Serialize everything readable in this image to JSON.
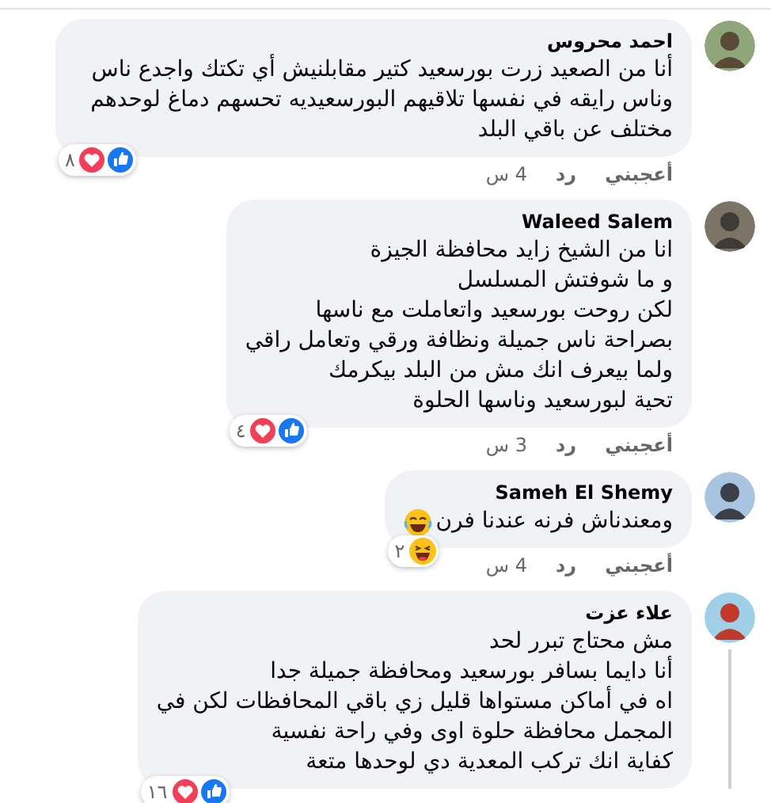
{
  "comments": [
    {
      "author": "احمد محروس",
      "text": [
        "أنا من الصعيد زرت بورسعيد كتير مقابلنيش أي تكتك واجدع ناس وناس رايقه في نفسها تلاقيهم البورسعيديه تحسهم دماغ لوحدهم مختلف عن باقي البلد"
      ],
      "trailing_emoji": false,
      "reactions": [
        {
          "kind": "like"
        },
        {
          "kind": "love"
        }
      ],
      "reaction_count": "٨",
      "actions": [
        "أعجبني",
        "رد"
      ],
      "time": "4 س",
      "has_replies": false
    },
    {
      "author": "Waleed Salem",
      "text": [
        "انا من الشيخ زايد محافظة الجيزة",
        "و ما شوفتش المسلسل",
        "لكن روحت بورسعيد واتعاملت مع ناسها",
        "بصراحة ناس جميلة ونظافة ورقي وتعامل راقي",
        "ولما بيعرف انك مش من البلد بيكرمك",
        "تحية لبورسعيد وناسها الحلوة"
      ],
      "trailing_emoji": false,
      "reactions": [
        {
          "kind": "like"
        },
        {
          "kind": "love"
        }
      ],
      "reaction_count": "٤",
      "actions": [
        "أعجبني",
        "رد"
      ],
      "time": "3 س",
      "has_replies": false
    },
    {
      "author": "Sameh El Shemy",
      "text": [
        "ومعندناش فرنه عندنا فرن"
      ],
      "trailing_emoji": true,
      "reactions": [
        {
          "kind": "haha"
        }
      ],
      "reaction_count": "٢",
      "actions": [
        "أعجبني",
        "رد"
      ],
      "time": "4 س",
      "has_replies": false
    },
    {
      "author": "علاء عزت",
      "text": [
        "مش محتاج تبرر لحد",
        "أنا دايما بسافر بورسعيد ومحافظة جميلة جدا",
        "اه في أماكن مستواها قليل زي باقي المحافظات لكن في",
        "المجمل محافظة حلوة اوى وفي راحة نفسية",
        "كفاية انك تركب المعدية دي لوحدها متعة"
      ],
      "trailing_emoji": false,
      "reactions": [
        {
          "kind": "like"
        },
        {
          "kind": "love"
        }
      ],
      "reaction_count": "١٦",
      "has_replies": true
    }
  ]
}
